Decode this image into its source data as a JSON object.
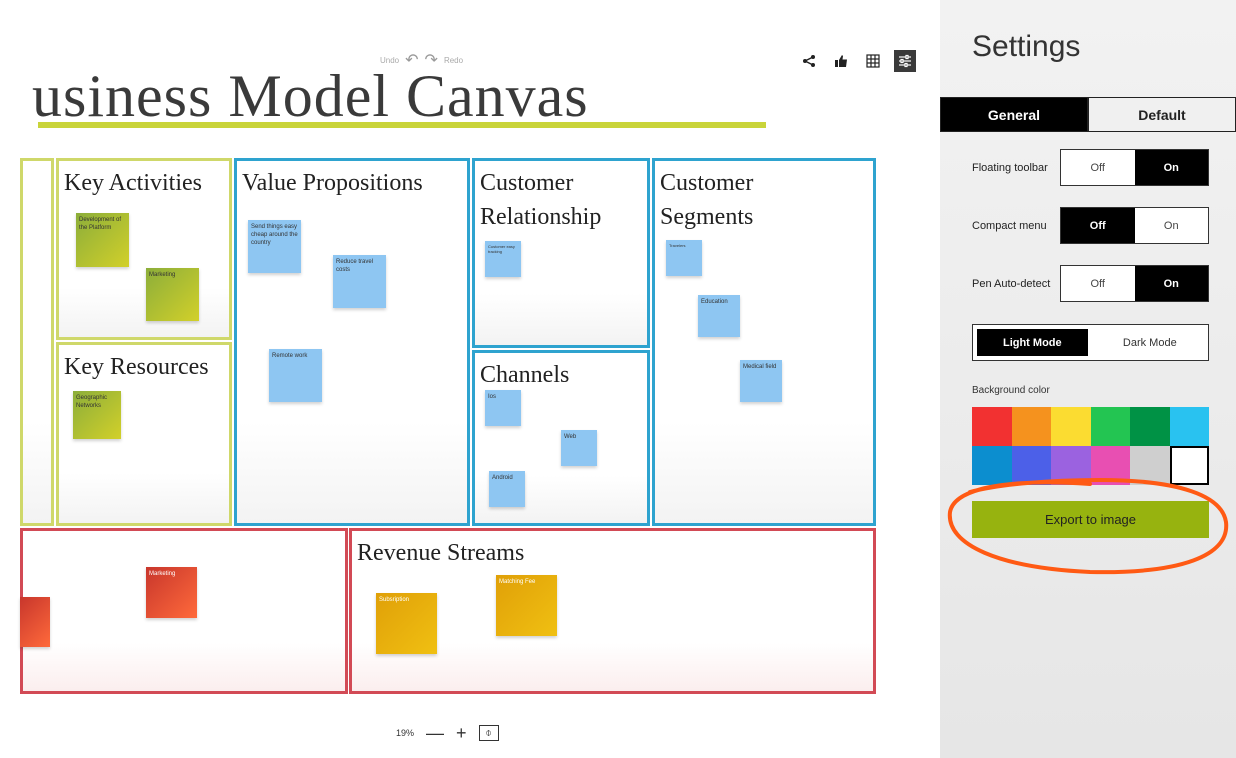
{
  "canvas": {
    "title": "usiness Model Canvas",
    "toolbar": {
      "undo_label": "Undo",
      "redo_label": "Redo"
    },
    "blocks": {
      "key_activities": {
        "title": "Key Activities"
      },
      "key_resources": {
        "title": "Key Resources"
      },
      "value_propositions": {
        "title": "Value Propositions"
      },
      "customer_relationship": {
        "title": "Customer Relationship"
      },
      "channels": {
        "title": "Channels"
      },
      "customer_segments": {
        "title": "Customer Segments"
      },
      "revenue_streams": {
        "title": "Revenue Streams"
      }
    },
    "notes": {
      "dev_platform": "Development of the Platform",
      "marketing_ka": "Marketing",
      "geo_networks": "Geographic Networks",
      "send_things": "Send things easy cheap around the country",
      "reduce_travel": "Reduce travel costs",
      "remote_work": "Remote work",
      "customer_self": "Customer easy tracking",
      "ios": "Ios",
      "web": "Web",
      "android": "Android",
      "cs_first": "Travelers",
      "education": "Education",
      "medical": "Medical field",
      "marketing_cost": "Marketing",
      "subscription": "Subsription",
      "matching_fee": "Matching Fee"
    },
    "zoom": {
      "value": "19%",
      "minus": "—",
      "plus": "+",
      "fit": "⌽"
    }
  },
  "settings": {
    "title": "Settings",
    "tabs": [
      "General",
      "Default"
    ],
    "floating_toolbar": {
      "label": "Floating toolbar",
      "off": "Off",
      "on": "On",
      "selected": "On"
    },
    "compact_menu": {
      "label": "Compact menu",
      "off": "Off",
      "on": "On",
      "selected": "Off"
    },
    "pen_auto_detect": {
      "label": "Pen Auto-detect",
      "off": "Off",
      "on": "On",
      "selected": "On"
    },
    "mode": {
      "light": "Light Mode",
      "dark": "Dark Mode",
      "selected": "Light Mode"
    },
    "background_color": {
      "label": "Background color",
      "colors": [
        "#f23131",
        "#f5921e",
        "#fbdc31",
        "#23c552",
        "#009245",
        "#29c2f0",
        "#0c8ecf",
        "#4c60e8",
        "#9b62e0",
        "#e84fb2",
        "#cfcfcf",
        "#ffffff"
      ],
      "selected": "#ffffff"
    },
    "export_label": "Export to image",
    "annotation_color": "#ff5a14"
  }
}
